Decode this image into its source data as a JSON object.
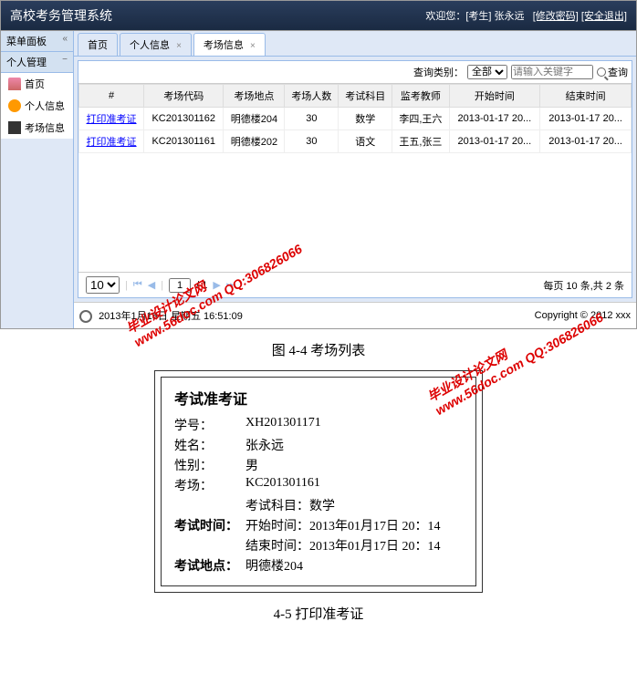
{
  "header": {
    "title": "高校考务管理系统",
    "welcome": "欢迎您：[考生] 张永远",
    "change_pwd": "[修改密码]",
    "logout": "[安全退出]"
  },
  "sidebar": {
    "panel_title": "菜单面板",
    "section_title": "个人管理",
    "items": [
      {
        "label": "首页"
      },
      {
        "label": "个人信息"
      },
      {
        "label": "考场信息"
      }
    ]
  },
  "tabs": [
    {
      "label": "首页",
      "closable": false
    },
    {
      "label": "个人信息",
      "closable": true
    },
    {
      "label": "考场信息",
      "closable": true,
      "active": true
    }
  ],
  "search": {
    "label": "查询类别：",
    "select_value": "全部",
    "placeholder": "请输入关键字",
    "button": "查询"
  },
  "table": {
    "headers": [
      "#",
      "考场代码",
      "考场地点",
      "考场人数",
      "考试科目",
      "监考教师",
      "开始时间",
      "结束时间"
    ],
    "rows": [
      {
        "action": "打印准考证",
        "code": "KC201301162",
        "place": "明德楼204",
        "count": "30",
        "subject": "数学",
        "teacher": "李四,王六",
        "start": "2013-01-17 20...",
        "end": "2013-01-17 20..."
      },
      {
        "action": "打印准考证",
        "code": "KC201301161",
        "place": "明德楼202",
        "count": "30",
        "subject": "语文",
        "teacher": "王五,张三",
        "start": "2013-01-17 20...",
        "end": "2013-01-17 20..."
      }
    ]
  },
  "pagination": {
    "page_size": "10",
    "current": "1",
    "total_pages": "/ 1",
    "summary": "每页 10 条,共 2 条"
  },
  "footer": {
    "datetime": "2013年1月18日 星期五 16:51:09",
    "copyright": "Copyright © 2012 xxx"
  },
  "watermark": {
    "line1": "毕业设计论文网",
    "line2": "www.56doc.com   QQ:306826066"
  },
  "caption1": "图 4-4 考场列表",
  "caption2": "4-5 打印准考证",
  "certificate": {
    "title": "考试准考证",
    "student_id_label": "学号：",
    "student_id": "XH201301171",
    "name_label": "姓名：",
    "name": "张永远",
    "gender_label": "性别：",
    "gender": "男",
    "room_label": "考场：",
    "room": "KC201301161",
    "subject_line": "考试科目：数学",
    "time_label": "考试时间：",
    "start_line": "开始时间：2013年01月17日 20：14",
    "end_line": "结束时间：2013年01月17日 20：14",
    "place_label": "考试地点：",
    "place": "明德楼204"
  }
}
